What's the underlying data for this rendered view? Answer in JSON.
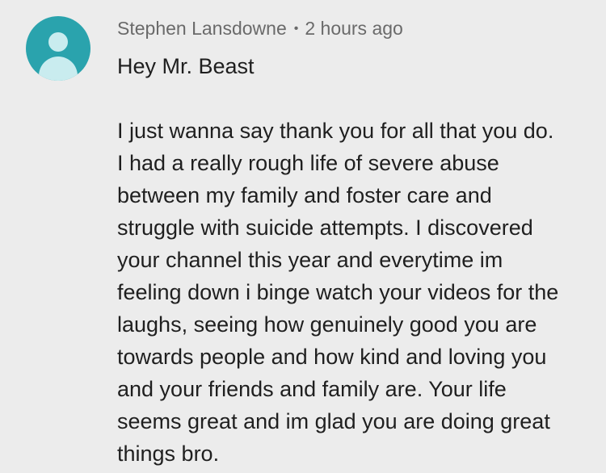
{
  "comment": {
    "author": "Stephen Lansdowne",
    "separator": "•",
    "timestamp": "2 hours ago",
    "avatar_icon": "default-user-avatar",
    "avatar_color": "#2aa3ad",
    "greeting": "Hey Mr. Beast",
    "body_lines": [
      "I just wanna say thank you for all that you do.",
      "I had a really rough life of severe abuse",
      "between my family and foster care and",
      "struggle with suicide attempts. I discovered",
      "your channel this year and everytime im",
      "feeling down i binge watch your videos for the",
      "laughs, seeing how genuinely good you are",
      "towards people and how kind and loving you",
      "and your friends and family are.  Your life",
      "seems great and im glad you are doing great",
      "things bro."
    ]
  }
}
